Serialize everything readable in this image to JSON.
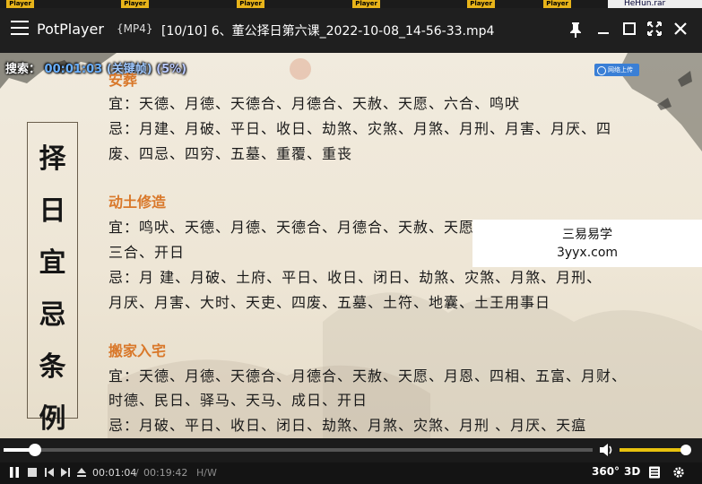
{
  "strip": {
    "thumb_badge": "Player",
    "file_label": "HeHun.rar"
  },
  "titlebar": {
    "app_name": "PotPlayer",
    "format": "{MP4}",
    "file_title": "[10/10] 6、董公择日第六课_2022-10-08_14-56-33.mp4",
    "icons": [
      "pin-icon",
      "minimize-icon",
      "maximize-icon",
      "fullscreen-icon",
      "close-icon"
    ]
  },
  "video": {
    "osd": {
      "action": "搜索：",
      "time": "00:01:03",
      "mode": "(关键帧)",
      "percent": "(5%)"
    },
    "badge": "网络上传",
    "vertical_title": [
      "择",
      "日",
      "宜",
      "忌",
      "条",
      "例"
    ],
    "sections": [
      {
        "heading": "安葬",
        "lines": [
          "宜：天德、月德、天德合、月德合、天赦、天愿、六合、鸣吠",
          "忌：月建、月破、平日、收日、劫煞、灾煞、月煞、月刑、月害、月厌、四",
          "废、四忌、四穷、五墓、重覆、重丧"
        ]
      },
      {
        "heading": "动土修造",
        "lines": [
          "宜：鸣吠、天德、月德、天德合、月德合、天赦、天愿、月恩、四相、时德",
          "三合、开日",
          "忌：月 建、月破、土府、平日、收日、闭日、劫煞、灾煞、月煞、月刑、",
          "月厌、月害、大时、天吏、四废、五墓、土符、地囊、土王用事日"
        ]
      },
      {
        "heading": "搬家入宅",
        "lines": [
          "宜：天德、月德、天德合、月德合、天赦、天愿、月恩、四相、五富、月财、",
          "时德、民日、驿马、天马、成日、开日",
          "忌：月破、平日、收日、闭日、劫煞、月煞、灾煞、月刑 、月厌、天瘟"
        ]
      }
    ],
    "watermark": {
      "line1": "三易易学",
      "line2": "3yyx.com"
    }
  },
  "seekbar": {
    "progress": 0.054,
    "volume": 1.0
  },
  "controls": {
    "current_time": "00:01:04",
    "separator": "/",
    "total_time": "00:19:42",
    "hw_label": "H/W",
    "btn_360": "360°",
    "btn_3d": "3D",
    "icons": [
      "pause-icon",
      "stop-icon",
      "prev-icon",
      "next-icon",
      "eject-icon",
      "playlist-icon",
      "settings-icon"
    ]
  }
}
